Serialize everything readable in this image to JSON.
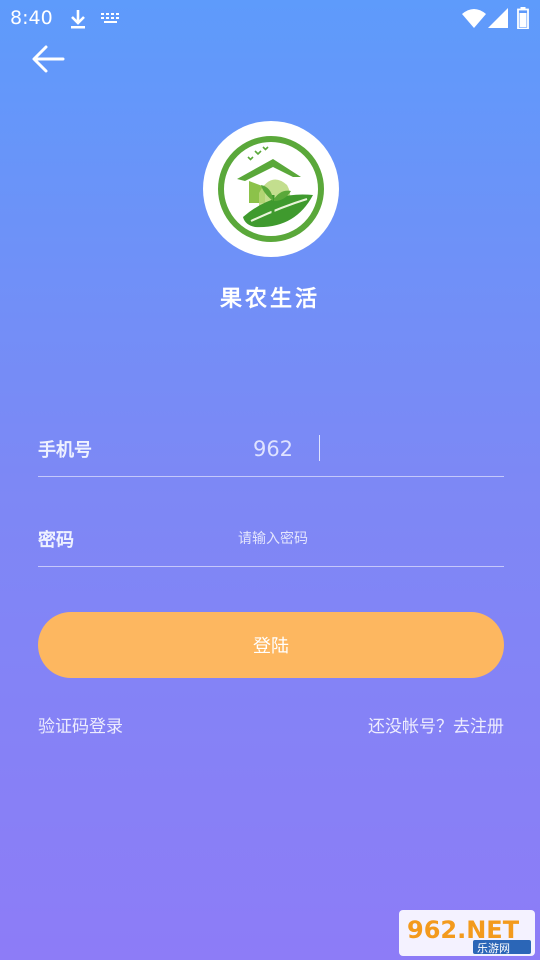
{
  "status_bar": {
    "time": "8:40",
    "icons": [
      "download-icon",
      "keyboard-icon",
      "wifi-icon",
      "signal-icon",
      "battery-icon"
    ]
  },
  "header": {
    "back_icon": "arrow-left-icon"
  },
  "app": {
    "name": "果农生活",
    "logo_icon": "farm-leaf-logo"
  },
  "form": {
    "phone_label": "手机号",
    "phone_value": "962",
    "password_label": "密码",
    "password_placeholder": "请输入密码",
    "login_label": "登陆"
  },
  "links": {
    "sms_login": "验证码登录",
    "register": "还没帐号？去注册"
  },
  "watermark": {
    "brand": "962.NET",
    "sub": "乐游网"
  },
  "colors": {
    "gradient_top": "#5e9bfb",
    "gradient_bottom": "#8d7cf7",
    "login_button": "#fdb760",
    "logo_green": "#5aa83a"
  }
}
